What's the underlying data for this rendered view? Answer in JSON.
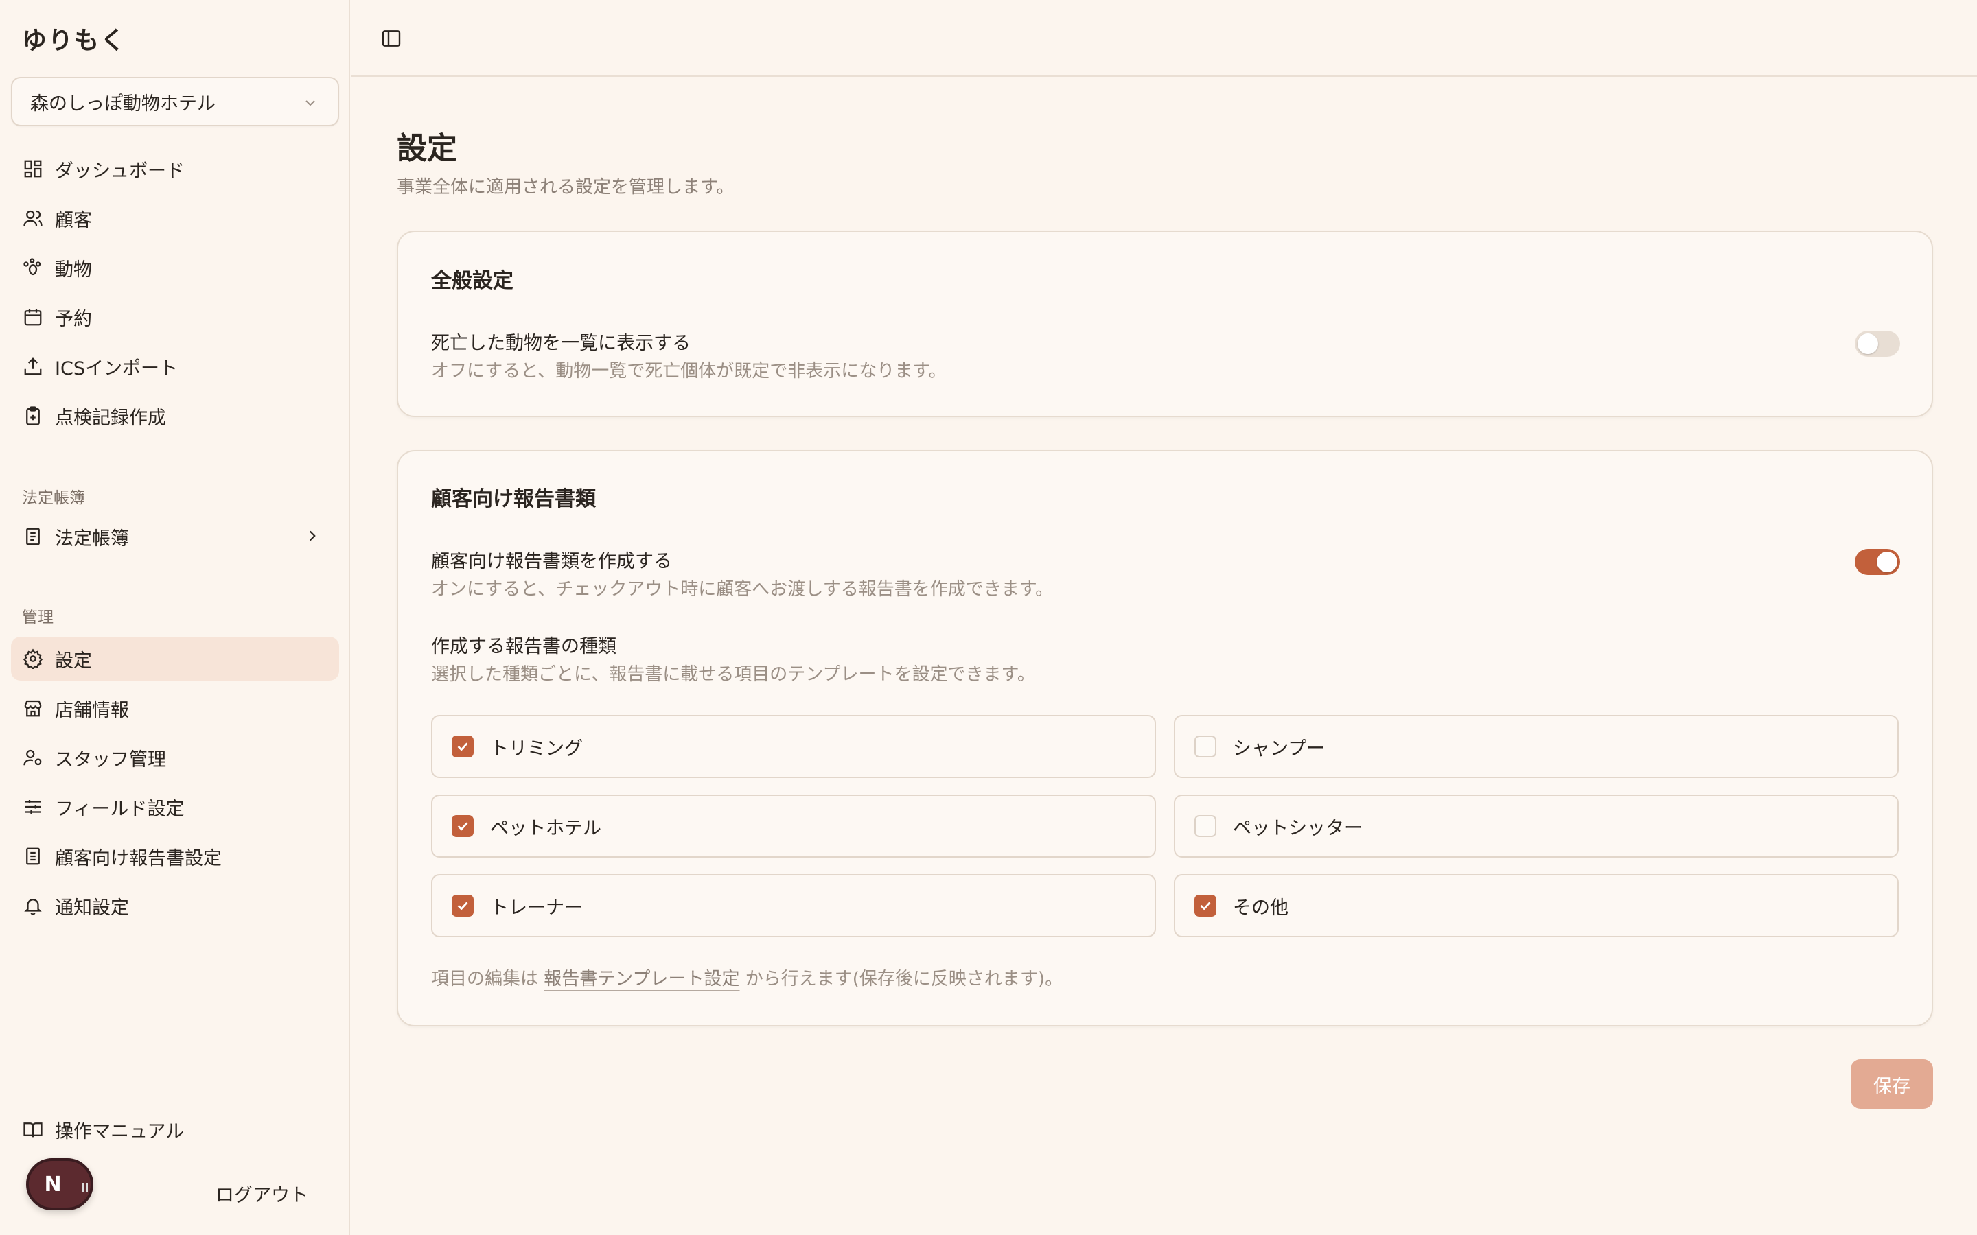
{
  "sidebar": {
    "brand": "ゆりもく",
    "store_select": "森のしっぽ動物ホテル",
    "items": [
      {
        "label": "ダッシュボード"
      },
      {
        "label": "顧客"
      },
      {
        "label": "動物"
      },
      {
        "label": "予約"
      },
      {
        "label": "ICSインポート"
      },
      {
        "label": "点検記録作成"
      }
    ],
    "section_ledger": "法定帳簿",
    "ledger_item": "法定帳簿",
    "section_admin": "管理",
    "admin_items": [
      {
        "label": "設定"
      },
      {
        "label": "店舗情報"
      },
      {
        "label": "スタッフ管理"
      },
      {
        "label": "フィールド設定"
      },
      {
        "label": "顧客向け報告書設定"
      },
      {
        "label": "通知設定"
      }
    ],
    "manual": "操作マニュアル",
    "avatar_initial": "N",
    "logout": "ログアウト"
  },
  "page": {
    "title": "設定",
    "subtitle": "事業全体に適用される設定を管理します。"
  },
  "general": {
    "title": "全般設定",
    "show_deceased_label": "死亡した動物を一覧に表示する",
    "show_deceased_desc": "オフにすると、動物一覧で死亡個体が既定で非表示になります。",
    "show_deceased_on": false
  },
  "reports": {
    "title": "顧客向け報告書類",
    "create_label": "顧客向け報告書類を作成する",
    "create_desc": "オンにすると、チェックアウト時に顧客へお渡しする報告書を作成できます。",
    "create_on": true,
    "types_label": "作成する報告書の種類",
    "types_desc": "選択した種類ごとに、報告書に載せる項目のテンプレートを設定できます。",
    "types": [
      {
        "label": "トリミング",
        "checked": true
      },
      {
        "label": "シャンプー",
        "checked": false
      },
      {
        "label": "ペットホテル",
        "checked": true
      },
      {
        "label": "ペットシッター",
        "checked": false
      },
      {
        "label": "トレーナー",
        "checked": true
      },
      {
        "label": "その他",
        "checked": true
      }
    ],
    "footnote_pre": "項目の編集は",
    "footnote_link": "報告書テンプレート設定",
    "footnote_post": "から行えます(保存後に反映されます)。"
  },
  "actions": {
    "save": "保存"
  },
  "colors": {
    "accent": "#c2603b",
    "background": "#fcf5ee",
    "active_nav": "#f7e4d8",
    "save_disabled": "#e3aa93"
  }
}
